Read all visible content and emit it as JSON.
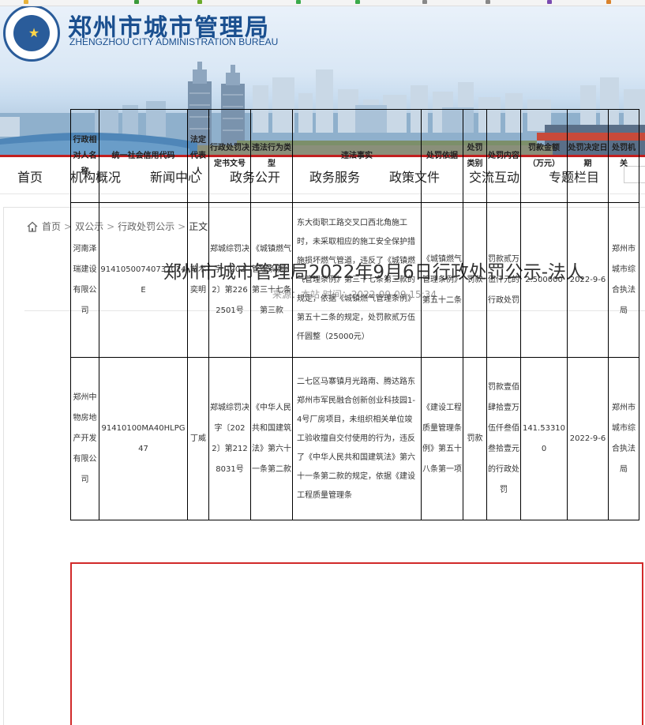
{
  "site": {
    "title": "郑州市城市管理局",
    "subtitle": "ZHENGZHOU CITY ADMINISTRATION BUREAU"
  },
  "nav": {
    "items": [
      "首页",
      "机构概况",
      "新闻中心",
      "政务公开",
      "政务服务",
      "政策文件",
      "交流互动",
      "专题栏目"
    ]
  },
  "breadcrumb": {
    "items": [
      "首页",
      "双公示",
      "行政处罚公示",
      "正文"
    ]
  },
  "article": {
    "title": "郑州市城市管理局2022年9月6日行政处罚公示-法人",
    "meta": "来源：本站  时间：2022-09-09 15:34"
  },
  "table": {
    "headers": [
      "行政相对人名称",
      "统一社会信用代码",
      "法定代表人",
      "行政处罚决定书文号",
      "违法行为类型",
      "违法事实",
      "处罚依据",
      "处罚类别",
      "处罚内容",
      "罚款金额（万元）",
      "处罚决定日期",
      "处罚机关"
    ],
    "rows": [
      {
        "name": "河南泽瑞建设有限公司",
        "code": "91410500740737024E",
        "rep": "端木奕明",
        "doc": "郑城综罚决字〔2022〕第2262501号",
        "type": "《城镇燃气管理条例》第三十七条第三款",
        "facts": "东大街职工路交叉口西北角施工时，未采取相应的施工安全保护措施损坏燃气管道，违反了《城镇燃气管理条例》第三十七条第三款的规定，依据《城镇燃气管理条例》第五十二条的规定，处罚款贰万伍仟圆整（25000元）",
        "basis": "《城镇燃气管理条例》第五十二条",
        "category": "罚款",
        "content": "罚款贰万伍仟元的行政处罚",
        "amount": "2.500000",
        "date": "2022-9-6",
        "agency": "郑州市城市综合执法局"
      },
      {
        "name": "郑州中物房地产开发有限公司",
        "code": "91410100MA40HLPG47",
        "rep": "丁威",
        "doc": "郑城综罚决字〔2022〕第2128031号",
        "type": "《中华人民共和国建筑法》第六十一条第二款",
        "facts": "二七区马寨镇月光路南、腾达路东郑州市军民融合创新创业科技园1-4号厂房项目，未组织相关单位竣工验收擅自交付使用的行为，违反了《中华人民共和国建筑法》第六十一条第二款的规定，依据《建设工程质量管理条",
        "basis": "《建设工程质量管理条例》第五十八条第一项",
        "category": "罚款",
        "content": "罚款壹佰肆拾壹万伍仟叁佰叁拾壹元的行政处罚",
        "amount": "141.533100",
        "date": "2022-9-6",
        "agency": "郑州市城市综合执法局"
      }
    ]
  },
  "colors": {
    "accent_red": "#c21f1f",
    "title_blue": "#1a4f8f",
    "highlight": "#d12a2a"
  }
}
